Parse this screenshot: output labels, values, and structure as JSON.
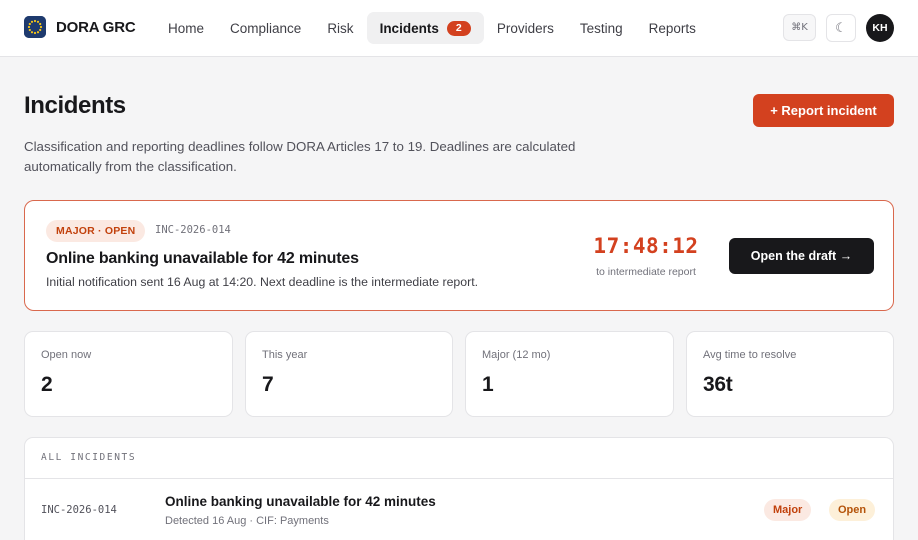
{
  "app": {
    "name": "DORA GRC",
    "logo_icon": "eu-flag-icon",
    "accent": "#d3411f"
  },
  "nav": {
    "items": [
      {
        "label": "Home"
      },
      {
        "label": "Compliance"
      },
      {
        "label": "Risk"
      },
      {
        "label": "Incidents",
        "badge": "2",
        "active": true
      },
      {
        "label": "Providers"
      },
      {
        "label": "Testing"
      },
      {
        "label": "Reports"
      }
    ]
  },
  "header_actions": {
    "shortcut": "⌘K",
    "theme_icon": "☾",
    "avatar_initials": "KH"
  },
  "page": {
    "title": "Incidents",
    "report_button": "+ Report incident",
    "description": "Classification and reporting deadlines follow DORA Articles 17 to 19. Deadlines are calculated automatically from the classification."
  },
  "alert": {
    "tag": "MAJOR · OPEN",
    "id": "INC-2026-014",
    "title": "Online banking unavailable for 42 minutes",
    "subtitle": "Initial notification sent 16 Aug at 14:20. Next deadline is the intermediate report.",
    "countdown": "17:48:12",
    "countdown_label": "to intermediate report",
    "action": "Open the draft →"
  },
  "stats": [
    {
      "label": "Open now",
      "value": "2"
    },
    {
      "label": "This year",
      "value": "7"
    },
    {
      "label": "Major (12 mo)",
      "value": "1"
    },
    {
      "label": "Avg time to resolve",
      "value": "36t"
    }
  ],
  "incidents": {
    "heading": "ALL INCIDENTS",
    "rows": [
      {
        "id": "INC-2026-014",
        "title": "Online banking unavailable for 42 minutes",
        "meta": "Detected 16 Aug · CIF: Payments",
        "severity": "Major",
        "status": "Open"
      }
    ]
  }
}
